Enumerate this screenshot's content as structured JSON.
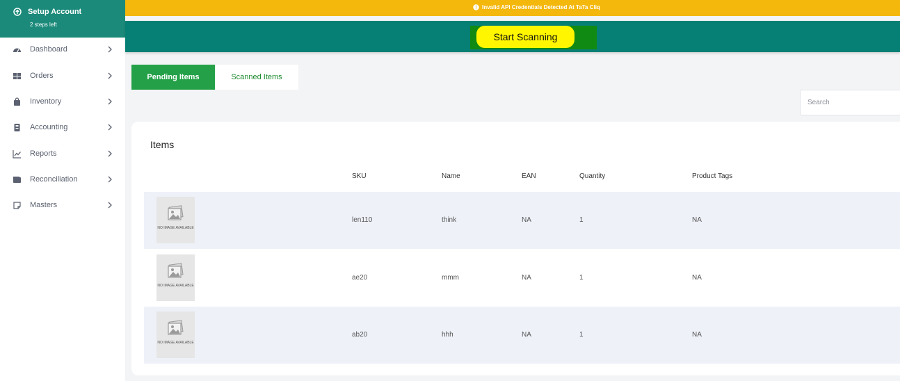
{
  "setup": {
    "title": "Setup Account",
    "subtitle": "2 steps left"
  },
  "sidebar": {
    "items": [
      {
        "label": "Dashboard",
        "icon": "dashboard-icon"
      },
      {
        "label": "Orders",
        "icon": "grid-icon"
      },
      {
        "label": "Inventory",
        "icon": "bag-icon"
      },
      {
        "label": "Accounting",
        "icon": "ledger-icon"
      },
      {
        "label": "Reports",
        "icon": "chart-icon"
      },
      {
        "label": "Reconciliation",
        "icon": "wallet-icon"
      },
      {
        "label": "Masters",
        "icon": "note-icon"
      }
    ]
  },
  "alert": {
    "text": "Invalid API Credentials Detected At TaTa Cliq",
    "color": "#f4b70c"
  },
  "scan": {
    "button_label": "Start Scanning"
  },
  "tabs": {
    "pending": "Pending Items",
    "scanned": "Scanned Items"
  },
  "search": {
    "placeholder": "Search"
  },
  "items": {
    "title": "Items",
    "columns": [
      "SKU",
      "Name",
      "EAN",
      "Quantity",
      "Product Tags"
    ],
    "no_image_text": "NO IMAGE AVAILABLE",
    "rows": [
      {
        "sku": "len110",
        "name": "think",
        "ean": "NA",
        "quantity": "1",
        "tags": "NA"
      },
      {
        "sku": "ae20",
        "name": "mmm",
        "ean": "NA",
        "quantity": "1",
        "tags": "NA"
      },
      {
        "sku": "ab20",
        "name": "hhh",
        "ean": "NA",
        "quantity": "1",
        "tags": "NA"
      }
    ]
  },
  "colors": {
    "brand": "#1b8a7a",
    "active_tab": "#24a148",
    "scan_button": "#fff600"
  }
}
